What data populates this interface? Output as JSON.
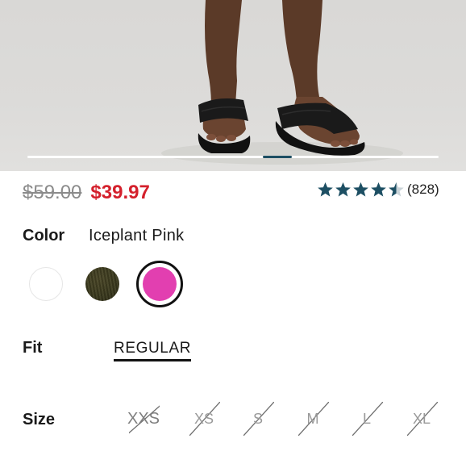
{
  "gallery": {
    "image": "black-slide-sandals-photo",
    "progress_fraction": 0.07
  },
  "price": {
    "original": "$59.00",
    "sale": "$39.97",
    "sale_color": "#d4202c"
  },
  "rating": {
    "stars": 4.5,
    "max_stars": 5,
    "count": "(828)",
    "star_color": "#1d4f63"
  },
  "color": {
    "label": "Color",
    "selected_value": "Iceplant Pink",
    "swatches": [
      {
        "name": "white",
        "color": "#ffffff"
      },
      {
        "name": "olive",
        "color": "#3b3a1e"
      },
      {
        "name": "iceplant-pink",
        "color": "#e23fb0",
        "selected": true
      }
    ]
  },
  "fit": {
    "label": "Fit",
    "options": [
      "REGULAR"
    ]
  },
  "size": {
    "label": "Size",
    "options": [
      "XXS",
      "XS",
      "S",
      "M",
      "L",
      "XL"
    ]
  }
}
